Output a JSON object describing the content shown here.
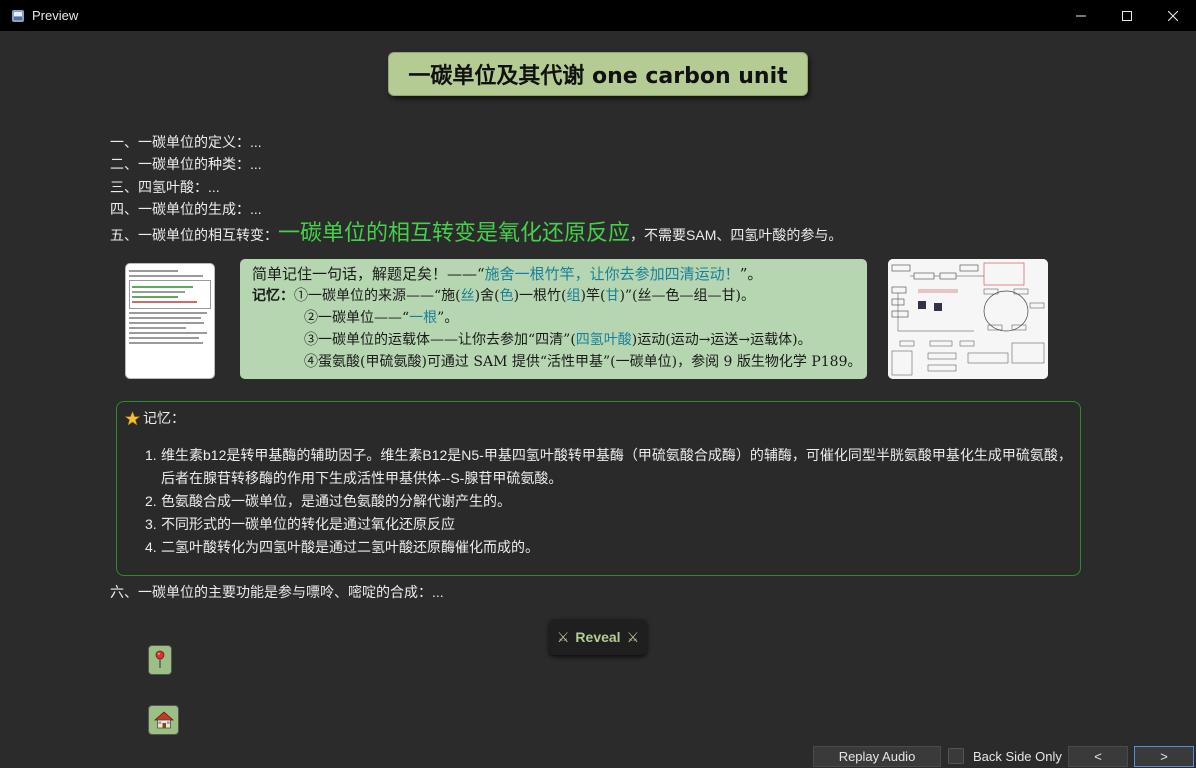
{
  "window": {
    "title": "Preview",
    "icons": {
      "app": "app-icon",
      "minimize": "minimize-icon",
      "maximize": "maximize-icon",
      "close": "close-icon"
    }
  },
  "card": {
    "title": "一碳单位及其代谢 one carbon unit",
    "outline": [
      "一、一碳单位的定义：...",
      "二、一碳单位的种类：...",
      "三、四氢叶酸：...",
      "四、一碳单位的生成：..."
    ],
    "item5": {
      "prefix": "五、一碳单位的相互转变：",
      "highlight": "一碳单位的相互转变是氧化还原反应",
      "suffix": "，不需要SAM、四氢叶酸的参与。"
    },
    "image_mid": {
      "line1_a": "简单记住一句话，解题足矣！——“",
      "line1_hl": "施舍一根竹竿，让你去参加四清运动！",
      "line1_b": "”。",
      "mem_label": "记忆：",
      "rows": [
        [
          "①一碳单位的来源——“施(",
          "丝",
          ")舍(",
          "色",
          ")一根竹(",
          "组",
          ")竿(",
          "甘",
          ")”(丝—色—组—甘)。"
        ],
        [
          "②一碳单位——“",
          "一根",
          "”。"
        ],
        [
          "③一碳单位的运载体——让你去参加“四清”(",
          "四氢叶酸",
          ")运动(运动→运送→运载体)。"
        ],
        [
          "④蛋氨酸(甲硫氨酸)可通过 SAM 提供“活性甲基”(一碳单位)，参阅 9 版生物化学 P189。"
        ]
      ]
    },
    "memo": {
      "icon": "star-icon",
      "label": "记忆：",
      "items": [
        {
          "num": "1.",
          "text": "维生素b12是转甲基酶的辅助因子。维生素B12是N5-甲基四氢叶酸转甲基酶（甲硫氨酸合成酶）的辅酶，可催化同型半胱氨酸甲基化生成甲硫氨酸，后者在腺苷转移酶的作用下生成活性甲基供体--S-腺苷甲硫氨酸。"
        },
        {
          "num": "2.",
          "text": "色氨酸合成一碳单位，是通过色氨酸的分解代谢产生的。"
        },
        {
          "num": "3.",
          "text": "不同形式的一碳单位的转化是通过氧化还原反应"
        },
        {
          "num": "4.",
          "text": "二氢叶酸转化为四氢叶酸是通过二氢叶酸还原酶催化而成的。"
        }
      ]
    },
    "item6": "六、一碳单位的主要功能是参与嘌呤、嘧啶的合成：...",
    "reveal": {
      "label": "Reveal",
      "icon": "crossed-swords-icon"
    },
    "side_buttons": {
      "pin": "pushpin-icon",
      "home": "home-icon"
    }
  },
  "bottom": {
    "replay_audio": "Replay Audio",
    "back_side_only": "Back Side Only",
    "back_side_only_checked": false,
    "prev": "<",
    "next": ">"
  },
  "colors": {
    "accent_green": "#44d04a",
    "title_bg": "#b4cc94",
    "memo_border": "#2f8a2f",
    "background": "#2b2b2b"
  }
}
